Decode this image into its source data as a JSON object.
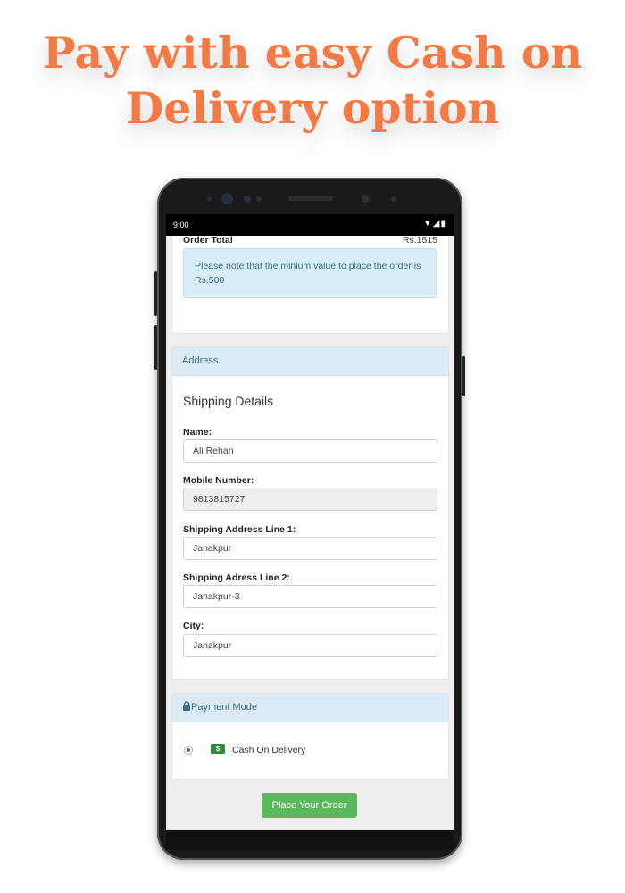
{
  "headline": {
    "line1": "Pay with easy Cash on",
    "line2": "Delivery option"
  },
  "colors": {
    "headline": "#f47a45",
    "panel_head": "#dbeaf4",
    "button": "#5cb85c",
    "note_bg": "#d9edf7"
  },
  "status_bar": {
    "time": "9:00",
    "icons": "▼◢▮"
  },
  "order": {
    "total_label": "Order Total",
    "total_value": "Rs.1515",
    "note": "Please note that the minium value to place the order is Rs.500"
  },
  "address": {
    "header": "Address",
    "section_title": "Shipping Details",
    "fields": [
      {
        "label": "Name:",
        "value": "Ali Rehan"
      },
      {
        "label": "Mobile Number:",
        "value": "9813815727"
      },
      {
        "label": "Shipping Address Line 1:",
        "value": "Janakpur"
      },
      {
        "label": "Shipping Adress Line 2:",
        "value": "Janakpur-3"
      },
      {
        "label": "City:",
        "value": "Janakpur"
      }
    ]
  },
  "payment": {
    "header": "Payment Mode",
    "header_icon": "lock-icon",
    "option_icon": "cash-icon",
    "option_label": "Cash On Delivery"
  },
  "place_order_label": "Place Your Order"
}
